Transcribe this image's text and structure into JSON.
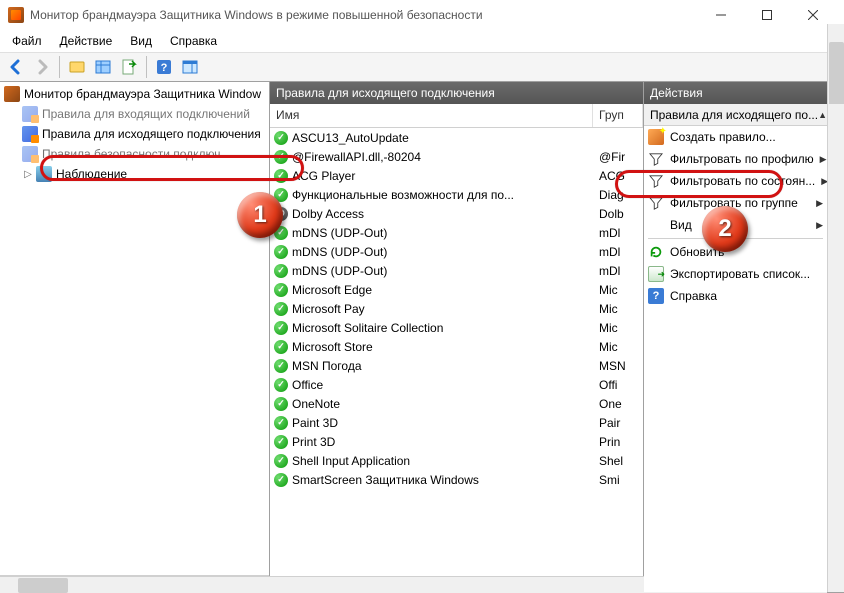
{
  "window": {
    "title": "Монитор брандмауэра Защитника Windows в режиме повышенной безопасности"
  },
  "menu": {
    "file": "Файл",
    "action": "Действие",
    "view": "Вид",
    "help": "Справка"
  },
  "tree": {
    "root": "Монитор брандмауэра Защитника Window",
    "inbound": "Правила для входящих подключений",
    "outbound": "Правила для исходящего подключения",
    "security": "Правила безопасности подключ...",
    "monitor": "Наблюдение"
  },
  "list": {
    "header": "Правила для исходящего подключения",
    "col_name": "Имя",
    "col_group": "Груп",
    "rows": [
      {
        "icon": "ok",
        "name": "ASCU13_AutoUpdate",
        "group": ""
      },
      {
        "icon": "ok",
        "name": "@FirewallAPI.dll,-80204",
        "group": "@Fir"
      },
      {
        "icon": "ok",
        "name": "ACG Player",
        "group": "ACG"
      },
      {
        "icon": "ok",
        "name": "Функциональные возможности для по...",
        "group": "Diag"
      },
      {
        "icon": "block",
        "name": "Dolby Access",
        "group": "Dolb"
      },
      {
        "icon": "ok",
        "name": "mDNS (UDP-Out)",
        "group": "mDl"
      },
      {
        "icon": "ok",
        "name": "mDNS (UDP-Out)",
        "group": "mDl"
      },
      {
        "icon": "ok",
        "name": "mDNS (UDP-Out)",
        "group": "mDl"
      },
      {
        "icon": "ok",
        "name": "Microsoft Edge",
        "group": "Mic"
      },
      {
        "icon": "ok",
        "name": "Microsoft Pay",
        "group": "Mic"
      },
      {
        "icon": "ok",
        "name": "Microsoft Solitaire Collection",
        "group": "Mic"
      },
      {
        "icon": "ok",
        "name": "Microsoft Store",
        "group": "Mic"
      },
      {
        "icon": "ok",
        "name": "MSN Погода",
        "group": "MSN"
      },
      {
        "icon": "ok",
        "name": "Office",
        "group": "Offi"
      },
      {
        "icon": "ok",
        "name": "OneNote",
        "group": "One"
      },
      {
        "icon": "ok",
        "name": "Paint 3D",
        "group": "Pair"
      },
      {
        "icon": "ok",
        "name": "Print 3D",
        "group": "Prin"
      },
      {
        "icon": "ok",
        "name": "Shell Input Application",
        "group": "Shel"
      },
      {
        "icon": "ok",
        "name": "SmartScreen Защитника Windows",
        "group": "Smi"
      }
    ]
  },
  "actions": {
    "header": "Действия",
    "subheader": "Правила для исходящего по...",
    "new_rule": "Создать правило...",
    "filter_profile": "Фильтровать по профилю",
    "filter_state": "Фильтровать по состоян...",
    "filter_group": "Фильтровать по группе",
    "view": "Вид",
    "refresh": "Обновить",
    "export": "Экспортировать список...",
    "help": "Справка"
  },
  "annotations": {
    "badge1": "1",
    "badge2": "2"
  }
}
